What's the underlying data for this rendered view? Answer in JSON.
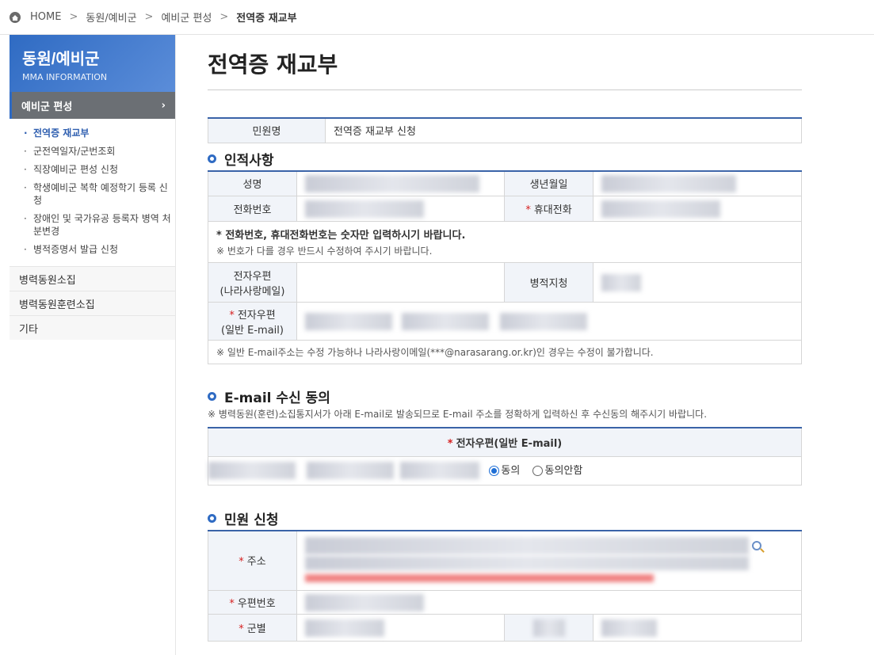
{
  "breadcrumb": {
    "home": "HOME",
    "items": [
      "동원/예비군",
      "예비군 편성",
      "전역증 재교부"
    ]
  },
  "sidebar": {
    "title": "동원/예비군",
    "subtitle": "MMA INFORMATION",
    "active_group": "예비군 편성",
    "sub_items": [
      "전역증 재교부",
      "군전역일자/군번조회",
      "직장예비군 편성 신청",
      "학생예비군 복학 예정학기 등록 신청",
      "장애인 및 국가유공 등록자 병역 처분변경",
      "병적증명서 발급 신청"
    ],
    "menu": [
      "병력동원소집",
      "병력동원훈련소집",
      "기타"
    ]
  },
  "page_title": "전역증 재교부",
  "civil": {
    "label": "민원명",
    "value": "전역증 재교부 신청"
  },
  "personal": {
    "title": "인적사항",
    "name_label": "성명",
    "birth_label": "생년월일",
    "phone_label": "전화번호",
    "mobile_label": "휴대전화",
    "note1": "* 전화번호, 휴대전화번호는 숫자만 입력하시기 바랍니다.",
    "note2": "※ 번호가 다를 경우 반드시 수정하여 주시기 바랍니다.",
    "epost_label": "전자우편",
    "epost_sub": "(나라사랑메일)",
    "office_label": "병적지청",
    "email_label": "전자우편",
    "email_sub": "(일반 E-mail)",
    "email_note": "※ 일반 E-mail주소는 수정 가능하나 나라사랑이메일(***@narasarang.or.kr)인 경우는 수정이 불가합니다."
  },
  "consent": {
    "title": "E-mail 수신 동의",
    "note": "※ 병력동원(훈련)소집통지서가 아래 E-mail로 발송되므로 E-mail 주소를 정확하게 입력하신 후 수신동의 해주시기 바랍니다.",
    "header": "전자우편(일반 E-mail)",
    "agree": "동의",
    "disagree": "동의안함"
  },
  "apply": {
    "title": "민원 신청",
    "address_label": "주소",
    "zip_label": "우편번호",
    "branch_label": "군별"
  },
  "required_mark": "*"
}
